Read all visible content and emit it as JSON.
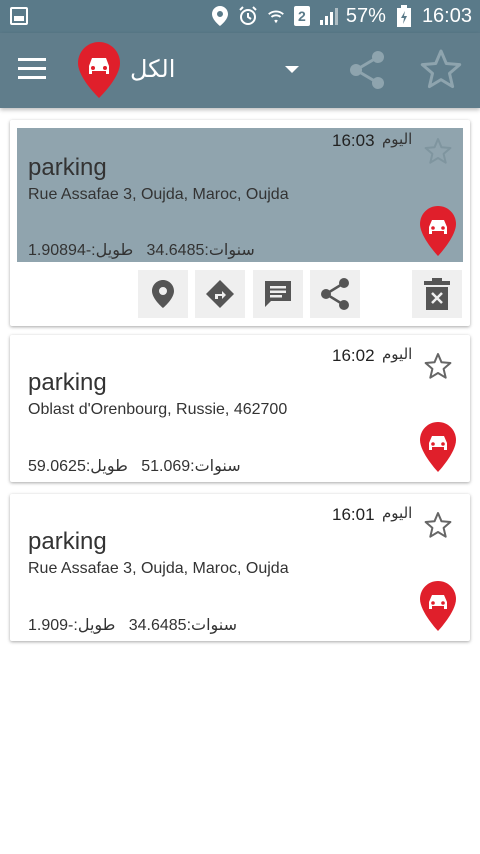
{
  "status_bar": {
    "battery": "57%",
    "time": "16:03",
    "sim_label": "2"
  },
  "app_bar": {
    "title": "الكل"
  },
  "colors": {
    "status_bar": "#5a7a89",
    "app_bar": "#607d8b",
    "selected_card": "#90a4ae",
    "pin_red": "#e01f2b"
  },
  "cards": [
    {
      "day": "اليوم",
      "time": "16:03",
      "title": "parking",
      "address": "Rue Assafae 3, Oujda, Maroc, Oujda",
      "lat_label": "سنوات:",
      "lat": "34.6485",
      "lon_label": "طويل:",
      "lon": "-1.90894",
      "selected": true
    },
    {
      "day": "اليوم",
      "time": "16:02",
      "title": "parking",
      "address": "Oblast d'Orenbourg, Russie, 462700",
      "lat_label": "سنوات:",
      "lat": "51.069",
      "lon_label": "طويل:",
      "lon": "59.0625",
      "selected": false
    },
    {
      "day": "اليوم",
      "time": "16:01",
      "title": "parking",
      "address": "Rue Assafae 3, Oujda, Maroc, Oujda",
      "lat_label": "سنوات:",
      "lat": "34.6485",
      "lon_label": "طويل:",
      "lon": "-1.909",
      "selected": false
    }
  ],
  "actions": [
    "map-pin-icon",
    "directions-icon",
    "message-icon",
    "share-icon",
    "delete-icon"
  ]
}
